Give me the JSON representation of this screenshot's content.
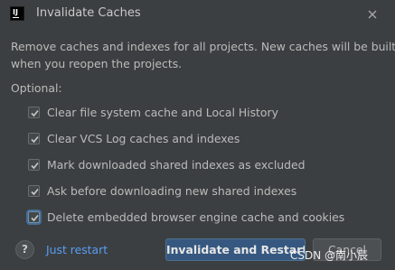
{
  "window": {
    "title": "Invalidate Caches",
    "logo_letters": "IJ"
  },
  "description": {
    "line1": "Remove caches and indexes for all projects. New caches will be built",
    "line2": "when you reopen the projects."
  },
  "optional_label": "Optional:",
  "options": [
    {
      "label": "Clear file system cache and Local History",
      "checked": true
    },
    {
      "label": "Clear VCS Log caches and indexes",
      "checked": true
    },
    {
      "label": "Mark downloaded shared indexes as excluded",
      "checked": true
    },
    {
      "label": "Ask before downloading new shared indexes",
      "checked": true
    },
    {
      "label": "Delete embedded browser engine cache and cookies",
      "checked": true,
      "focused": true
    }
  ],
  "footer": {
    "help_label": "?",
    "just_restart": "Just restart",
    "primary_button": "Invalidate and Restart",
    "cancel_button": "Cancel"
  },
  "watermark": "CSDN @南小辰",
  "colors": {
    "background": "#3c3f41",
    "link": "#589df6",
    "primary": "#365880"
  }
}
